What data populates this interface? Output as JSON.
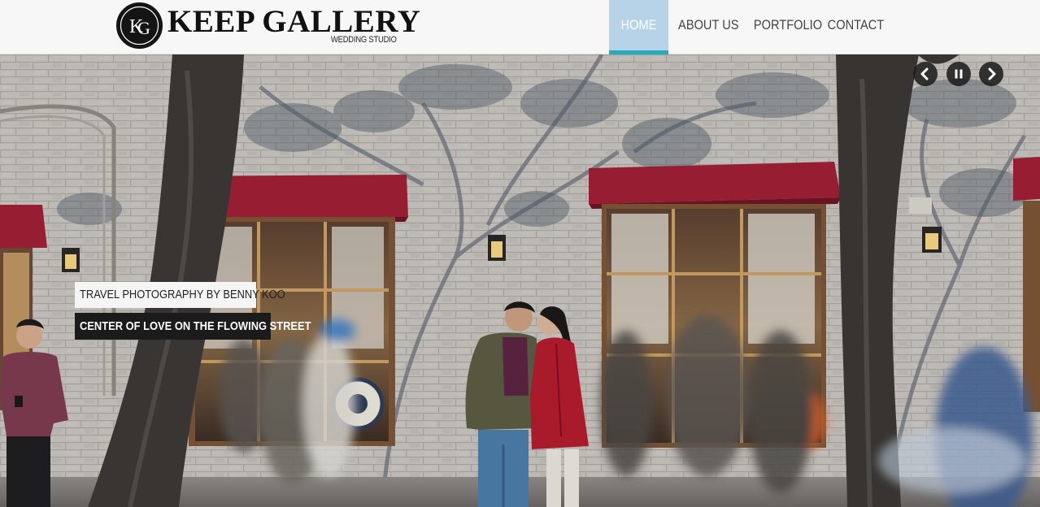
{
  "brand": {
    "monogram": "KG",
    "title": "KEEP GALLERY",
    "subtitle": "WEDDING STUDIO"
  },
  "nav": {
    "items": [
      {
        "label": "HOME",
        "active": true
      },
      {
        "label": "ABOUT US",
        "active": false
      },
      {
        "label": "PORTFOLIO",
        "active": false
      },
      {
        "label": "CONTACT",
        "active": false
      }
    ]
  },
  "slider": {
    "caption_primary": "TRAVEL PHOTOGRAPHY BY BENNY KOO",
    "caption_secondary": "CENTER OF LOVE ON THE FLOWING STREET",
    "controls": [
      {
        "name": "previous-slide",
        "icon": "chevron-left-icon"
      },
      {
        "name": "pause-slideshow",
        "icon": "pause-icon"
      },
      {
        "name": "next-slide",
        "icon": "chevron-right-icon"
      }
    ]
  },
  "colors": {
    "nav_active_bg": "#b7d3e8",
    "nav_active_bar": "#27a9c0",
    "awning_red": "#9e1f35",
    "brick_wall": "#b9b6b0"
  }
}
